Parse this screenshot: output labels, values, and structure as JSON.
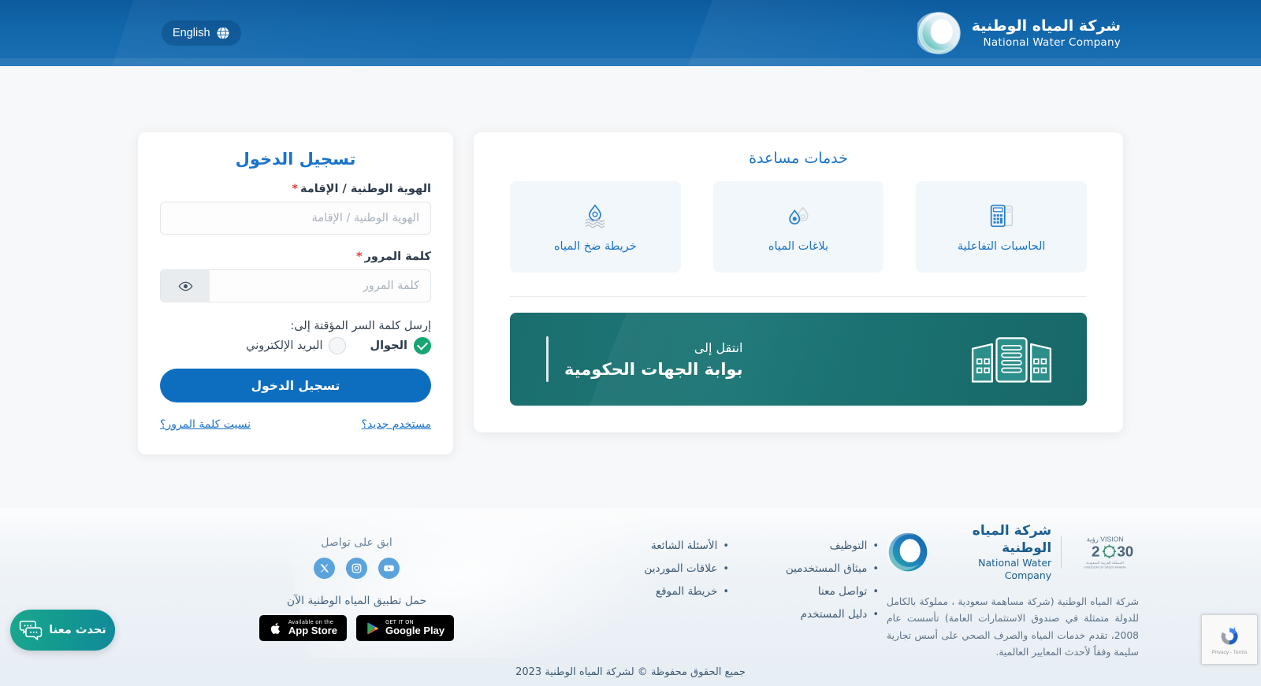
{
  "header": {
    "lang_button": "English",
    "lang_icon": "globe-icon",
    "brand_ar": "شركة المياه الوطنية",
    "brand_en": "National Water Company"
  },
  "login": {
    "title": "تسجيل الدخول",
    "id_label": "الهوية الوطنية / الإقامة",
    "id_placeholder": "الهوية الوطنية / الإقامة",
    "id_value": "",
    "password_label": "كلمة المرور",
    "password_placeholder": "كلمة المرور",
    "password_value": "",
    "eye_icon": "eye-icon",
    "required_mark": "*",
    "otp_label": "إرسل كلمة السر المؤقتة إلى:",
    "otp_options": [
      {
        "label": "الجوال",
        "selected": true
      },
      {
        "label": "البريد الإلكتروني",
        "selected": false
      }
    ],
    "submit_label": "تسجيل الدخول",
    "new_user_link": "مستخدم جديد؟",
    "forgot_link": "نسيت كلمة المرور؟"
  },
  "services": {
    "title": "خدمات مساعدة",
    "tiles": [
      {
        "label": "الحاسبات التفاعلية",
        "icon": "calculator-icon"
      },
      {
        "label": "بلاغات المياه",
        "icon": "water-report-icon"
      },
      {
        "label": "خريطة ضخ المياه",
        "icon": "water-pump-map-icon"
      }
    ],
    "banner": {
      "line1": "انتقل إلى",
      "line2": "بوابة الجهات الحكومية",
      "icon": "government-buildings-icon"
    }
  },
  "footer": {
    "brand_ar": "شركة المياه الوطنية",
    "brand_en": "National Water Company",
    "vision_logo": "vision-2030-logo",
    "description": "شركة المياه الوطنية (شركة مساهمة سعودية ، مملوكة بالكامل للدولة متمثلة في صندوق الاستثمارات العامة) تأسست عام 2008، تقدم خدمات المياه والصرف الصحي على أسس تجارية سليمة وفقاً لأحدث المعايير العالمية.",
    "links_col1": [
      "التوظيف",
      "ميثاق المستخدمين",
      "تواصل معنا",
      "دليل المستخدم"
    ],
    "links_col2": [
      "الأسئلة الشائعة",
      "علاقات الموردين",
      "خريطة الموقع"
    ],
    "social_title": "ابق على تواصل",
    "social": [
      {
        "name": "youtube-icon"
      },
      {
        "name": "instagram-icon"
      },
      {
        "name": "x-twitter-icon"
      }
    ],
    "app_title": "حمل تطبيق المياه الوطنية الآن",
    "stores": [
      {
        "small": "Available on the",
        "big": "App Store",
        "icon": "apple-icon"
      },
      {
        "small": "GET IT ON",
        "big": "Google Play",
        "icon": "google-play-icon"
      }
    ],
    "copyright": "جميع الحقوق محفوظة © لشركة المياه الوطنية 2023"
  },
  "chat": {
    "label": "تحدث معنا",
    "icon": "chat-bubbles-icon"
  },
  "recaptcha": {
    "legal": "Privacy - Terms",
    "icon": "recaptcha-icon"
  },
  "colors": {
    "header_blue": "#1267ab",
    "accent_blue": "#1a73c8",
    "button_blue": "#0d6ebf",
    "teal": "#1d7676",
    "green_check": "#17a673"
  }
}
